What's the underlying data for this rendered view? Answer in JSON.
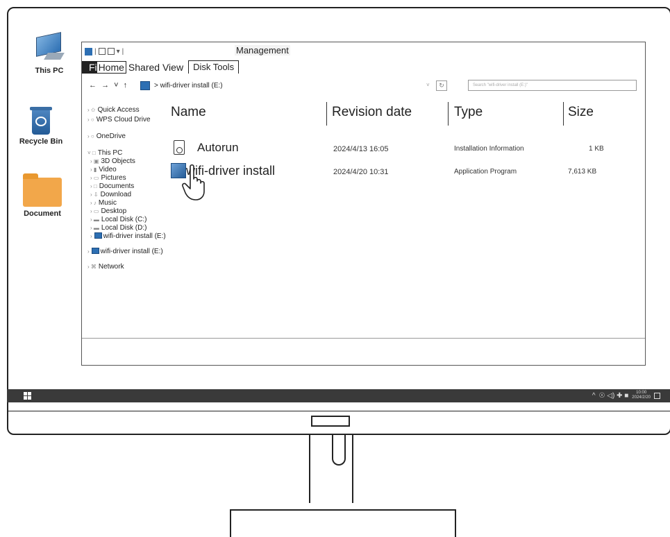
{
  "desktop": {
    "icons": [
      {
        "label": "This PC"
      },
      {
        "label": "Recycle Bin"
      },
      {
        "label": "Document"
      }
    ]
  },
  "explorer": {
    "quick_access": {
      "sep": "|",
      "dropdown": "▾",
      "tail": "|"
    },
    "contextual_tab": "Management",
    "tabs": {
      "file": "File",
      "home": "Home",
      "shared_view": "Shared View",
      "disk_tools": "Disk Tools"
    },
    "nav": {
      "back": "←",
      "forward": "→",
      "recent": "˅",
      "up": "↑"
    },
    "address": "> wifi-driver install (E:)",
    "address_dropdown": "˅",
    "refresh": "↻",
    "search_placeholder": "Search \"wifi-driver install (E:)\"",
    "sidebar": [
      {
        "label": "Quick Access",
        "prefix": "› ✩"
      },
      {
        "label": "WPS Cloud Drive",
        "prefix": "› ○"
      },
      {
        "label": "OneDrive",
        "prefix": "› ○"
      },
      {
        "label": "This PC",
        "prefix": "˅ □"
      },
      {
        "label": "3D Objects",
        "prefix": "› ▣"
      },
      {
        "label": "Video",
        "prefix": "› ▮"
      },
      {
        "label": "Pictures",
        "prefix": "› ▭"
      },
      {
        "label": "Documents",
        "prefix": "› □"
      },
      {
        "label": "Download",
        "prefix": "› ⇩"
      },
      {
        "label": "Music",
        "prefix": "› ♪"
      },
      {
        "label": "Desktop",
        "prefix": "› ▭"
      },
      {
        "label": "Local Disk (C:)",
        "prefix": "› ▬"
      },
      {
        "label": "Local Disk (D:)",
        "prefix": "› ▬"
      },
      {
        "label": "wifi-driver install (E:)",
        "prefix": "›"
      },
      {
        "label": "wifi-driver install (E:)",
        "prefix": "›"
      },
      {
        "label": "Network",
        "prefix": "› ⌘"
      }
    ],
    "columns": {
      "name": "Name",
      "revision": "Revision date",
      "type": "Type",
      "size": "Size"
    },
    "files": [
      {
        "name": "Autorun",
        "date": "2024/4/13 16:05",
        "type": "Installation Information",
        "size": "1 KB",
        "icon": "autorun-inf-icon"
      },
      {
        "name": "wifi-driver install",
        "date": "2024/4/20 10:31",
        "type": "Application Program",
        "size": "7,613 KB",
        "icon": "application-exe-icon"
      }
    ]
  },
  "taskbar": {
    "tray": {
      "chevron": "^",
      "icons": "☉ ◁) ✚ ■",
      "time": "10:00",
      "date": "2024/2/20"
    }
  },
  "colors": {
    "taskbar": "#3a3a3a",
    "drive_blue": "#2d6fb3",
    "folder": "#f2a74a"
  }
}
